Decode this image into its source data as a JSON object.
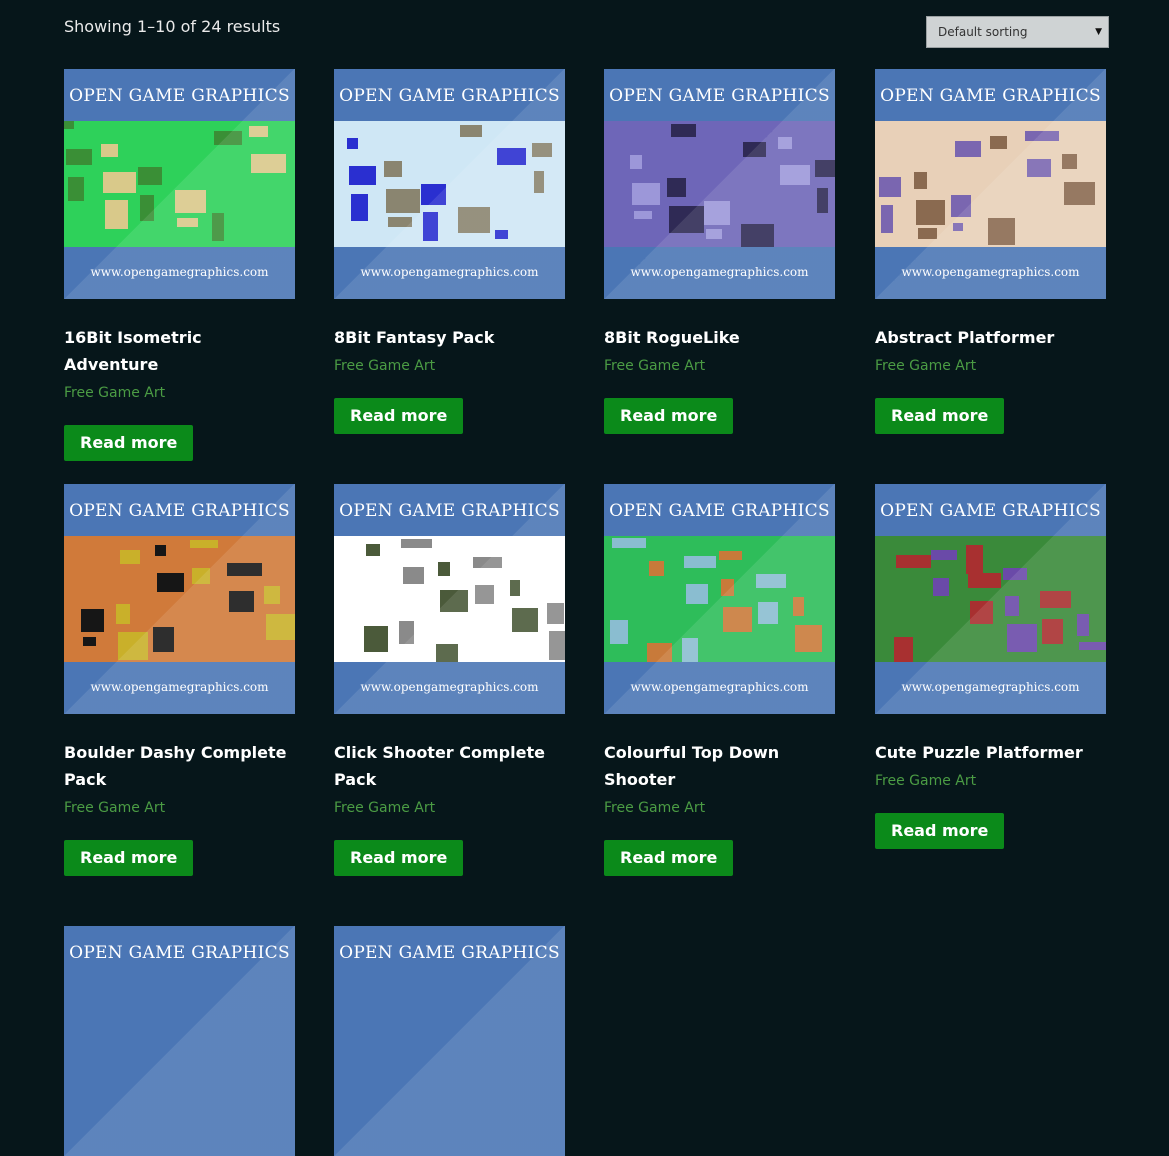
{
  "result_count": "Showing 1–10 of 24 results",
  "sorting": {
    "selected": "Default sorting"
  },
  "thumbnail": {
    "header": "OPEN GAME GRAPHICS",
    "footer": "www.opengamegraphics.com"
  },
  "products": [
    {
      "title": "16Bit Isometric Adventure",
      "category": "Free Game Art",
      "button": "Read more",
      "palette": [
        "#2ed15a",
        "#d9c98a",
        "#3a8f36"
      ]
    },
    {
      "title": "8Bit Fantasy Pack",
      "category": "Free Game Art",
      "button": "Read more",
      "palette": [
        "#cfe7f5",
        "#8a8570",
        "#2a2fd0"
      ]
    },
    {
      "title": "8Bit RogueLike",
      "category": "Free Game Art",
      "button": "Read more",
      "palette": [
        "#6e66b8",
        "#2f2a55",
        "#9c97d9"
      ]
    },
    {
      "title": "Abstract Platformer",
      "category": "Free Game Art",
      "button": "Read more",
      "palette": [
        "#e8d0b8",
        "#7a66b0",
        "#8a6a50"
      ]
    },
    {
      "title": "Boulder Dashy Complete Pack",
      "category": "Free Game Art",
      "button": "Read more",
      "palette": [
        "#d07a3a",
        "#161616",
        "#c9b02a"
      ]
    },
    {
      "title": "Click Shooter Complete Pack",
      "category": "Free Game Art",
      "button": "Read more",
      "palette": [
        "#ffffff",
        "#4b5a3a",
        "#8a8a8a"
      ]
    },
    {
      "title": "Colourful Top Down Shooter",
      "category": "Free Game Art",
      "button": "Read more",
      "palette": [
        "#2ebd5a",
        "#c87a3a",
        "#8abdd0"
      ]
    },
    {
      "title": "Cute Puzzle Platformer",
      "category": "Free Game Art",
      "button": "Read more",
      "palette": [
        "#3a8a3a",
        "#6a4aa8",
        "#a83030"
      ]
    },
    {
      "title": "",
      "category": "",
      "button": "",
      "palette": []
    },
    {
      "title": "",
      "category": "",
      "button": "",
      "palette": []
    }
  ]
}
